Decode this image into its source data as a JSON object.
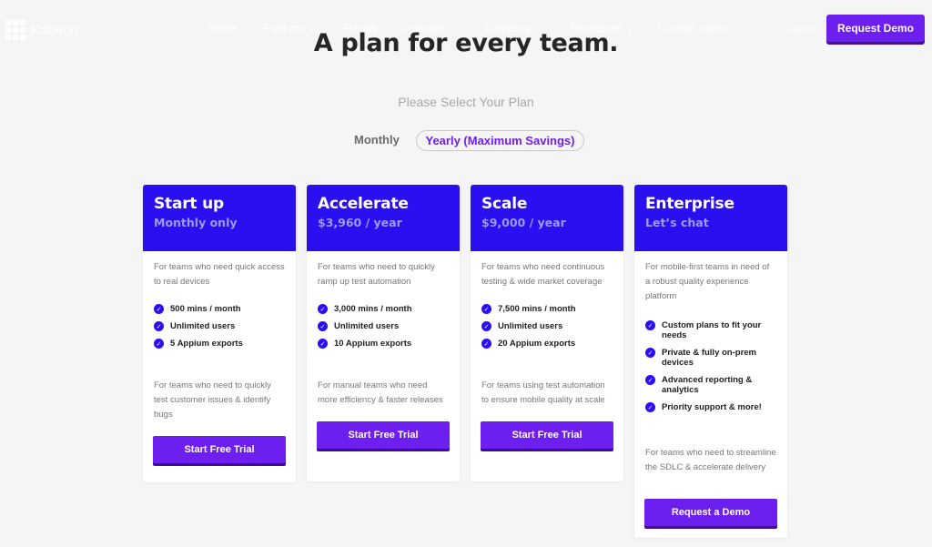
{
  "nav": {
    "logo_text": "Kobiton",
    "links": [
      {
        "label": "Home",
        "caret": ""
      },
      {
        "label": "Platform",
        "caret": "▾"
      },
      {
        "label": "Pricing",
        "caret": ""
      },
      {
        "label": "Solutions",
        "caret": "▾"
      },
      {
        "label": "Company",
        "caret": "▾"
      },
      {
        "label": "Resources",
        "caret": "▾"
      },
      {
        "label": "Contact Sales",
        "caret": ""
      }
    ],
    "login": "Login",
    "request_demo": "Request Demo"
  },
  "heading": {
    "title": "A plan for every team.",
    "subtitle": "Please Select Your Plan"
  },
  "billing_toggle": {
    "monthly": "Monthly",
    "yearly": "Yearly (Maximum Savings)",
    "selected": "Yearly (Maximum Savings)"
  },
  "plans": [
    {
      "name": "Start up",
      "price": "Monthly only",
      "description": "For teams who need quick access to real devices",
      "features": [
        "500 mins / month",
        "Unlimited users",
        "5 Appium exports"
      ],
      "footnote": "For teams who need to quickly test customer issues & identify bugs",
      "cta": "Start Free Trial"
    },
    {
      "name": "Accelerate",
      "price": "$3,960 / year",
      "description": "For teams who need to quickly ramp up test automation",
      "features": [
        "3,000 mins / month",
        "Unlimited users",
        "10 Appium exports"
      ],
      "footnote": "For manual teams who need more efficiency & faster releases",
      "cta": "Start Free Trial"
    },
    {
      "name": "Scale",
      "price": "$9,000 / year",
      "description": "For teams who need continuous testing & wide market coverage",
      "features": [
        "7,500 mins / month",
        "Unlimited users",
        "20 Appium exports"
      ],
      "footnote": "For teams using test automation to ensure mobile quality at scale",
      "cta": "Start Free Trial"
    },
    {
      "name": "Enterprise",
      "price": "Let’s chat",
      "description": "For mobile-first teams in need of a robust quality experience platform",
      "features": [
        "Custom plans to fit your needs",
        "Private & fully on-prem devices",
        "Advanced reporting & analytics",
        "Priority support & more!"
      ],
      "footnote": "For teams who need to streamline the SDLC & accelerate delivery",
      "cta": "Request a Demo"
    }
  ],
  "colors": {
    "card_header": "#2a10f0",
    "accent_purple": "#6d1ff0",
    "background": "#f5f5f5"
  },
  "icons": {
    "check": "check-circle-icon",
    "caret": "chevron-down-icon",
    "logo": "kobiton-grid-logo-icon"
  }
}
